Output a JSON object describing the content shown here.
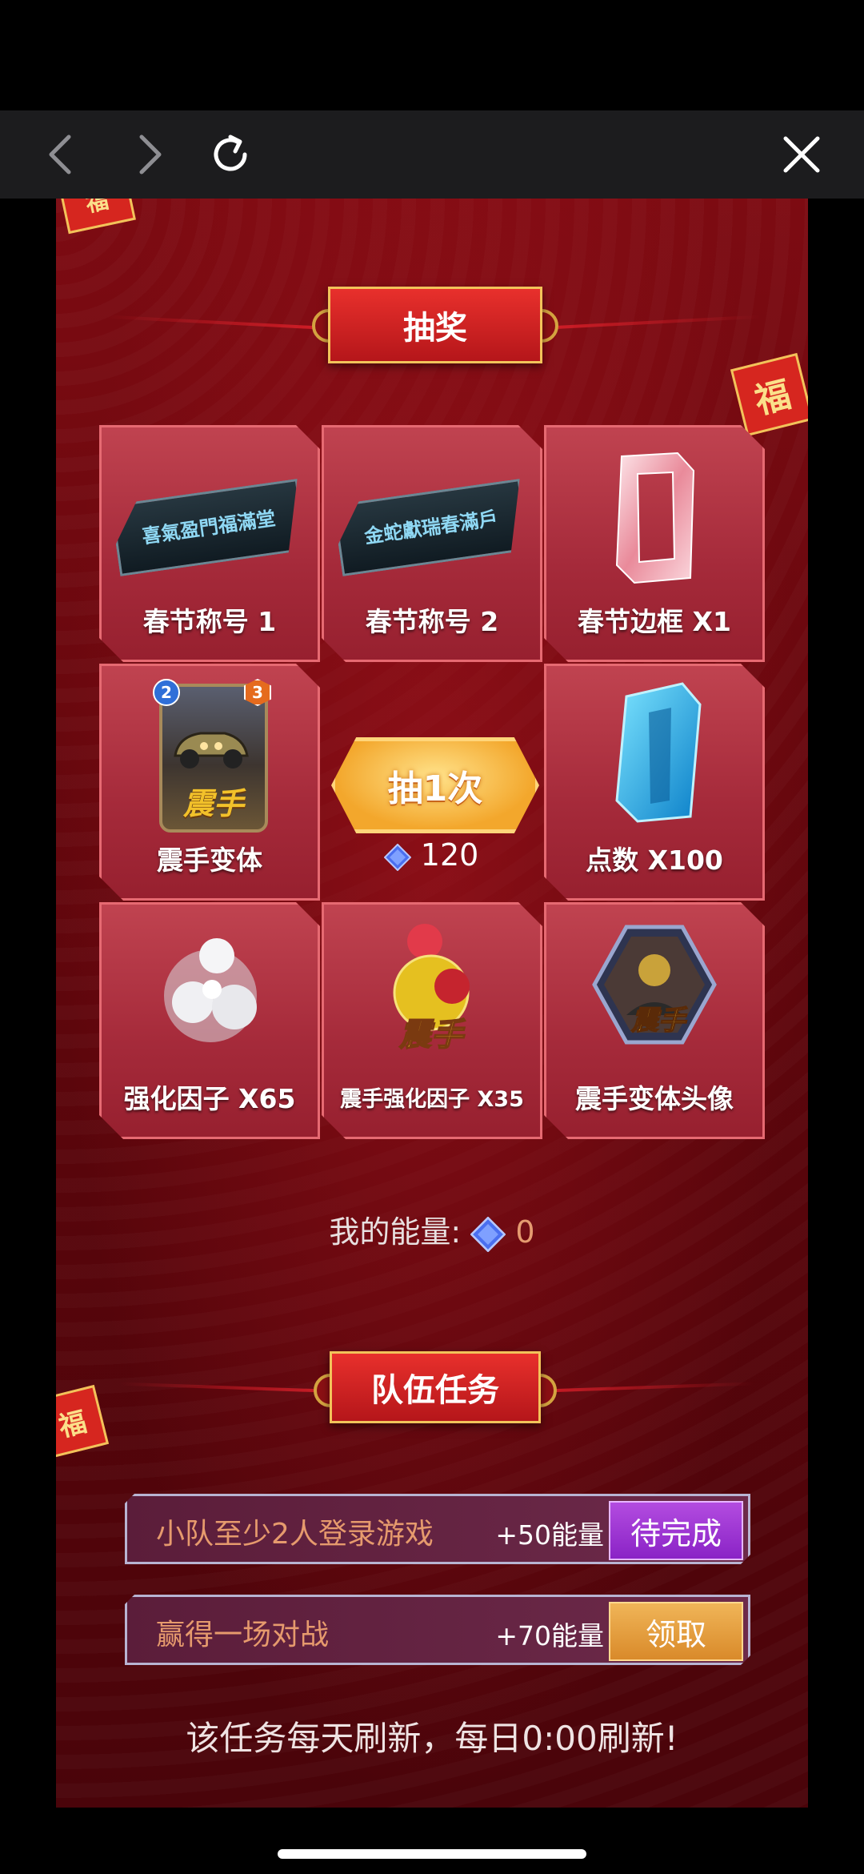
{
  "browser": {
    "back_icon": "chevron-left-icon",
    "forward_icon": "chevron-right-icon",
    "reload_icon": "reload-icon",
    "close_icon": "close-icon"
  },
  "decor": {
    "fu_char": "福"
  },
  "lottery": {
    "title": "抽奖",
    "prizes": [
      {
        "label": "春节称号 1",
        "badge": "喜氣盈門福滿堂"
      },
      {
        "label": "春节称号 2",
        "badge": "金蛇獻瑞春滿戶"
      },
      {
        "label": "春节边框 X1"
      },
      {
        "label": "震手变体"
      },
      {
        "label": "点数 X100"
      },
      {
        "label": "强化因子 X65"
      },
      {
        "label": "震手强化因子 X35"
      },
      {
        "label": "震手变体头像"
      }
    ],
    "draw_button": "抽1次",
    "draw_cost": "120",
    "card_cost": "2",
    "card_power": "3",
    "card_name": "震手",
    "energy_label": "我的能量:",
    "energy_value": "0"
  },
  "tasks": {
    "title": "队伍任务",
    "items": [
      {
        "text": "小队至少2人登录游戏",
        "reward": "+50能量",
        "button": "待完成"
      },
      {
        "text": "赢得一场对战",
        "reward": "+70能量",
        "button": "领取"
      }
    ],
    "note": "该任务每天刷新，每日0:00刷新!"
  },
  "colors": {
    "panel_red": "#7d0b12",
    "gold": "#f2c35a",
    "pending_purple": "#9b35d4",
    "claim_gold": "#e6a040",
    "task_text": "#e69a6d"
  }
}
